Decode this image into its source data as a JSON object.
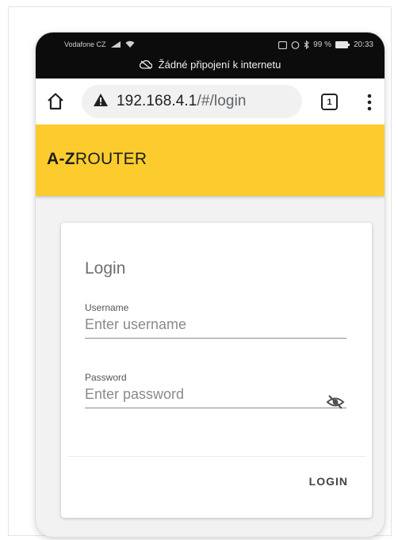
{
  "status_bar": {
    "carrier": "Vodafone CZ",
    "battery": "99 %",
    "time": "20:33",
    "offline_message": "Žádné připojení k internetu"
  },
  "browser": {
    "url_host": "192.168.4.1",
    "url_path": "/#/login",
    "tab_count": "1"
  },
  "app": {
    "brand_bold": "A-Z",
    "brand_rest": "ROUTER",
    "brand_color": "#fccc2e"
  },
  "login": {
    "title": "Login",
    "username_label": "Username",
    "username_placeholder": "Enter username",
    "password_label": "Password",
    "password_placeholder": "Enter password",
    "submit_label": "LOGIN"
  }
}
